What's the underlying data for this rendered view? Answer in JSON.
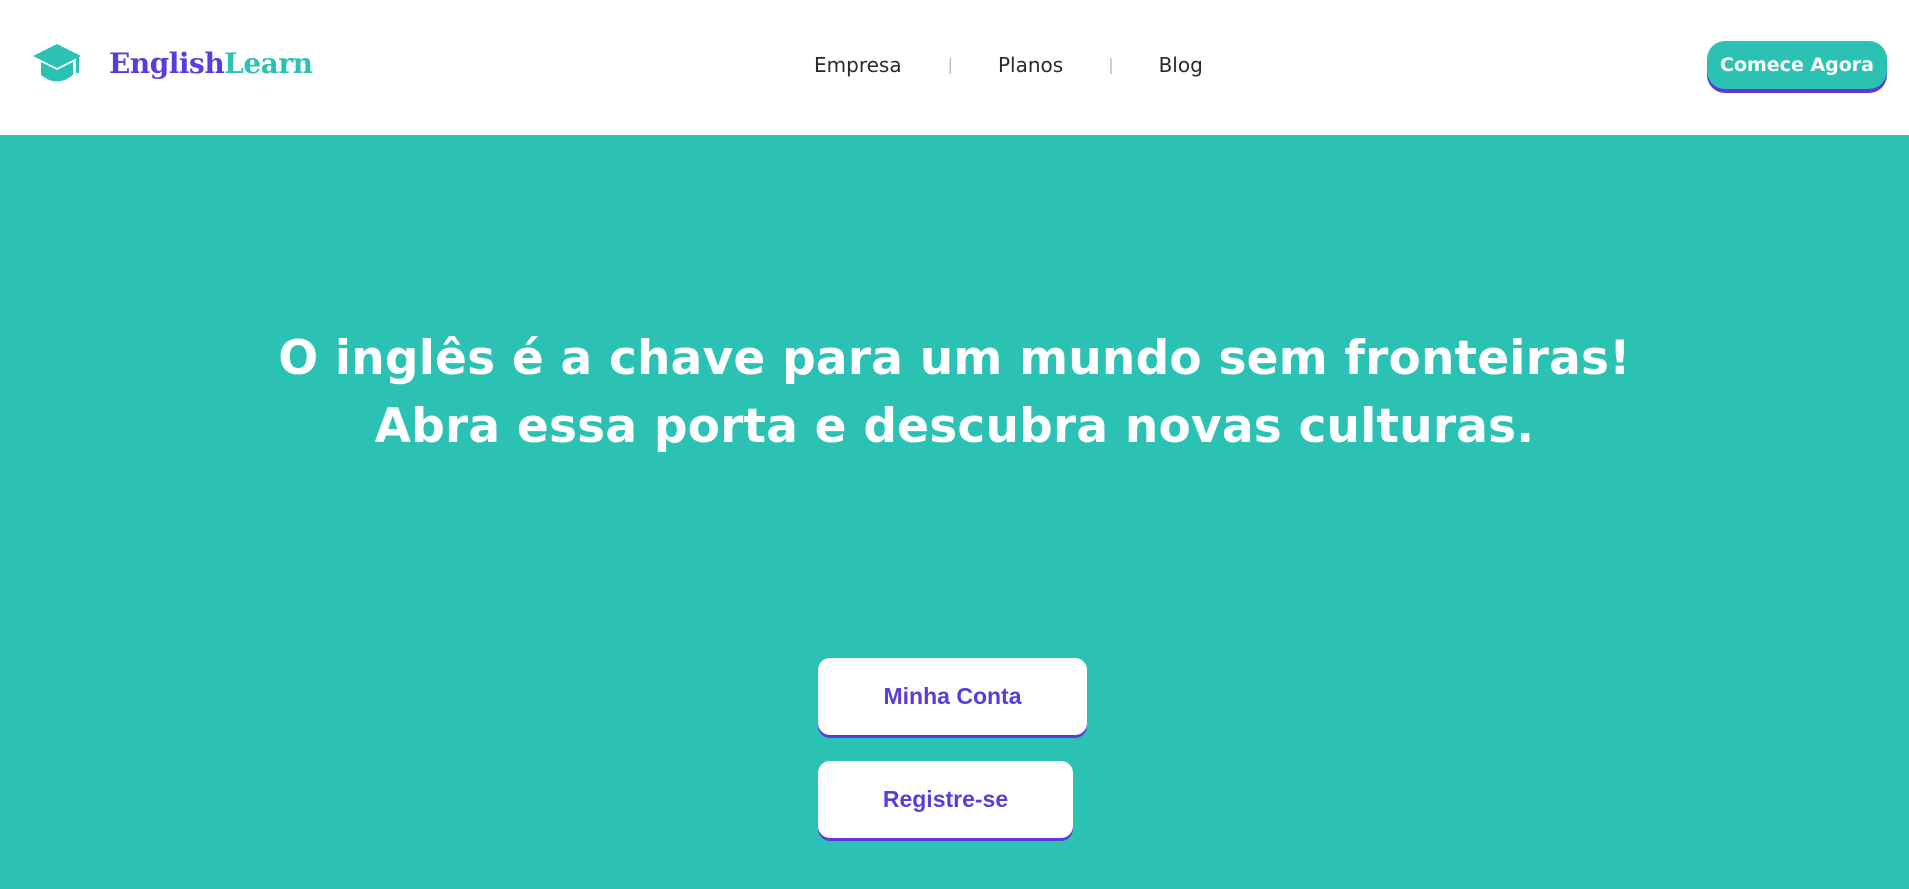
{
  "header": {
    "logo": {
      "icon": "graduation-cap-icon",
      "text_part1": "English",
      "text_part2": "Learn"
    },
    "nav": [
      {
        "label": "Empresa"
      },
      {
        "label": "Planos"
      },
      {
        "label": "Blog"
      }
    ],
    "separator": "|",
    "cta_label": "Comece Agora"
  },
  "hero": {
    "headline_line1": "O inglês é a chave para um mundo sem fronteiras!",
    "headline_line2": "Abra essa porta e descubra novas culturas.",
    "account_button": "Minha Conta",
    "register_button": "Registre-se"
  },
  "colors": {
    "primary_teal": "#2bc2b4",
    "accent_purple": "#5b3bdb",
    "header_bg": "#ffffff",
    "nav_text": "#2a2a2a"
  }
}
